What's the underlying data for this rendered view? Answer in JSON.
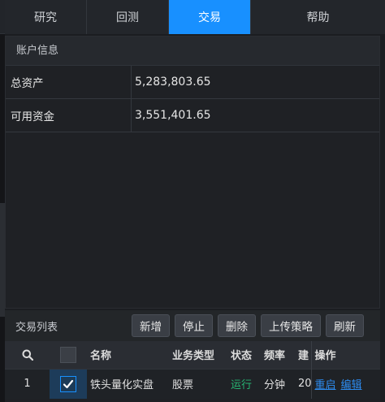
{
  "tabs": [
    {
      "label": "研究",
      "active": false
    },
    {
      "label": "回测",
      "active": false
    },
    {
      "label": "交易",
      "active": true
    },
    {
      "label": "帮助",
      "active": false
    }
  ],
  "account": {
    "title": "账户信息",
    "rows": [
      {
        "label": "总资产",
        "value": "5,283,803.65"
      },
      {
        "label": "可用资金",
        "value": "3,551,401.65"
      }
    ]
  },
  "trade_list": {
    "title": "交易列表",
    "buttons": {
      "add": "新增",
      "stop": "停止",
      "delete": "删除",
      "upload": "上传策略",
      "refresh": "刷新"
    },
    "columns": {
      "name": "名称",
      "type": "业务类型",
      "status": "状态",
      "freq": "频率",
      "created": "建",
      "ops": "操作"
    },
    "rows": [
      {
        "index": "1",
        "checked": true,
        "name": "铁头量化实盘",
        "type": "股票",
        "status": "运行",
        "freq": "分钟",
        "created": "20",
        "op_restart": "重启",
        "op_edit": "编辑"
      }
    ]
  },
  "colors": {
    "accent": "#1890ff",
    "status_running": "#27b473",
    "link": "#2d8cf0"
  }
}
